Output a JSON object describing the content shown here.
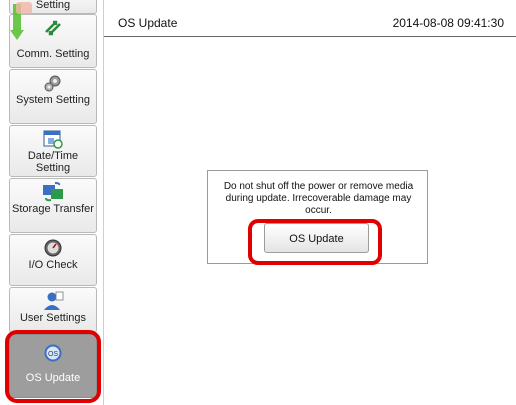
{
  "header": {
    "title": "OS Update",
    "datetime": "2014-08-08 09:41:30"
  },
  "sidebar": {
    "items": [
      {
        "label": "Setting",
        "icon": "setting-icon"
      },
      {
        "label": "Comm. Setting",
        "icon": "comm-icon"
      },
      {
        "label": "System Setting",
        "icon": "gears-icon"
      },
      {
        "label": "Date/Time Setting",
        "icon": "calendar-icon"
      },
      {
        "label": "Storage Transfer",
        "icon": "storage-transfer-icon"
      },
      {
        "label": "I/O Check",
        "icon": "gauge-icon"
      },
      {
        "label": "User Settings",
        "icon": "user-icon"
      },
      {
        "label": "OS Update",
        "icon": "os-icon"
      }
    ]
  },
  "dialog": {
    "message": "Do not shut off the power or remove media during update. Irrecoverable damage may occur.",
    "button_label": "OS Update"
  },
  "colors": {
    "highlight": "#e00000",
    "active_item": "#9d9d9d"
  }
}
